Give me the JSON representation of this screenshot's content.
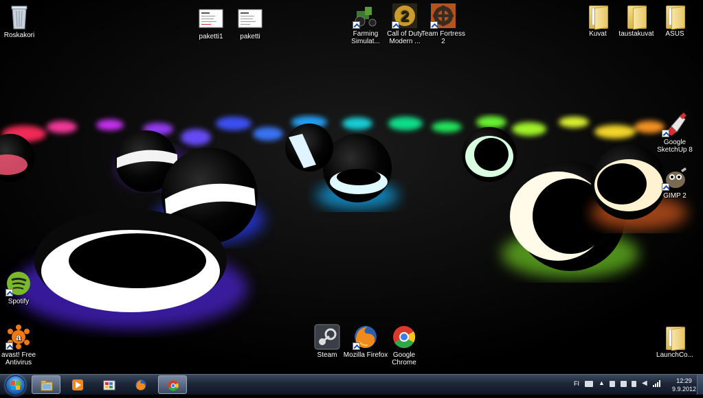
{
  "desktop": {
    "icons": {
      "recycle_bin": "Roskakori",
      "paketti1": "paketti1",
      "paketti": "paketti",
      "farming": "Farming Simulat...",
      "cod": "Call of Duty Modern ...",
      "tf2": "Team Fortress 2",
      "kuvat": "Kuvat",
      "taustakuvat": "taustakuvat",
      "asus": "ASUS",
      "sketchup": "Google SketchUp 8",
      "gimp": "GIMP 2",
      "spotify": "Spotify",
      "avast": "avast! Free Antivirus",
      "steam": "Steam",
      "firefox": "Mozilla Firefox",
      "chrome": "Google Chrome",
      "launchco": "LaunchCo..."
    }
  },
  "taskbar": {
    "language": "FI",
    "time": "12:29",
    "date": "9.9.2012"
  },
  "colors": {
    "taskbar_top": "#3c4a5e",
    "taskbar_bottom": "#0e1624",
    "desktop_bg": "#000000"
  }
}
